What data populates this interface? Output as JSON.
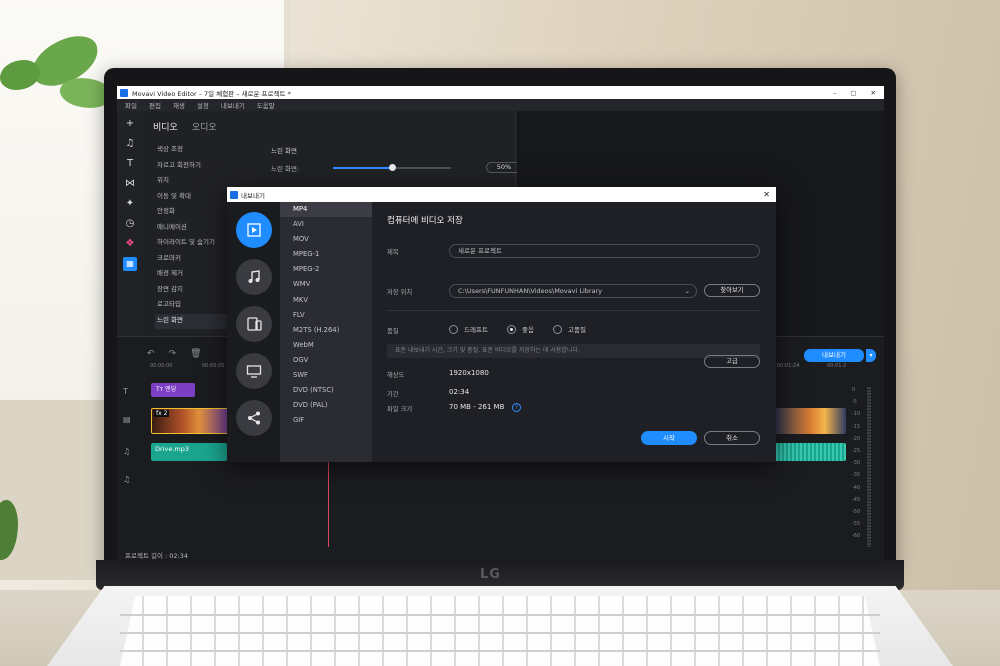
{
  "app": {
    "window_title": "Movavi Video Editor – 7일 체험판 – 새로운 프로젝트 *",
    "win_controls": [
      "–",
      "▢",
      "✕"
    ],
    "menu": [
      "파일",
      "편집",
      "재생",
      "설정",
      "내보내기",
      "도움말"
    ]
  },
  "toolstrip": {
    "icons": [
      "plus-icon",
      "music-icon",
      "text-icon",
      "transition-icon",
      "sparkle-icon",
      "clock-icon",
      "sticker-icon",
      "more-tools-icon"
    ]
  },
  "panel": {
    "tabs": [
      "비디오",
      "오디오"
    ],
    "fx_list": [
      "색상 조정",
      "자르고 회전하기",
      "위치",
      "이동 및 확대",
      "안정화",
      "애니메이션",
      "하이라이트 및 숨기기",
      "크로마키",
      "배경 제거",
      "장면 감지",
      "로고타입",
      "느린 화면"
    ],
    "selected_fx": "느린 화면",
    "detail_title": "느린 화면",
    "slider_label": "느린 화면:",
    "slider_value_text": "50%",
    "slider_value": 0.5
  },
  "timeline": {
    "ruler": [
      "00:00:00",
      "00:00:05",
      "00:01:24",
      "00:01:2"
    ],
    "text_clip": "엔딩",
    "video_clip_badge": "fx 2",
    "audio_clip": "Drive.mp3",
    "export_button": "내보내기",
    "meter_ticks": [
      "0",
      "-5",
      "-10",
      "-15",
      "-20",
      "-25",
      "-30",
      "-35",
      "-40",
      "-45",
      "-50",
      "-55",
      "-60"
    ],
    "project_length_label": "프로젝트 길이 : 02:34"
  },
  "dialog": {
    "title": "내보내기",
    "close": "✕",
    "categories": [
      "video-file-icon",
      "audio-note-icon",
      "devices-icon",
      "tv-icon",
      "share-icon"
    ],
    "formats": [
      "MP4",
      "AVI",
      "MOV",
      "MPEG-1",
      "MPEG-2",
      "WMV",
      "MKV",
      "FLV",
      "M2TS (H.264)",
      "WebM",
      "OGV",
      "SWF",
      "DVD (NTSC)",
      "DVD (PAL)",
      "GIF"
    ],
    "selected_format": "MP4",
    "heading": "컴퓨터에 비디오 저장",
    "name_label": "제목",
    "name_value": "새로운 프로젝트",
    "location_label": "저장 위치",
    "location_value": "C:\\Users\\FUNFUNHAN\\Videos\\Movavi Library",
    "browse_button": "찾아보기",
    "quality_label": "품질",
    "quality_options": [
      "드래프트",
      "좋음",
      "고품질"
    ],
    "quality_selected": "좋음",
    "hint": "표준 내보내기 시간, 크기 및 품질. 표준 비디오를 저장하는 데 사용합니다.",
    "resolution_label": "해상도",
    "resolution_value": "1920x1080",
    "duration_label": "기간",
    "duration_value": "02:34",
    "advanced_button": "고급",
    "filesize_label": "파일 크기",
    "filesize_value": "70 MB - 261 MB",
    "help": "?",
    "start_button": "시작",
    "cancel_button": "취소"
  },
  "laptop": {
    "brand": "LG"
  }
}
